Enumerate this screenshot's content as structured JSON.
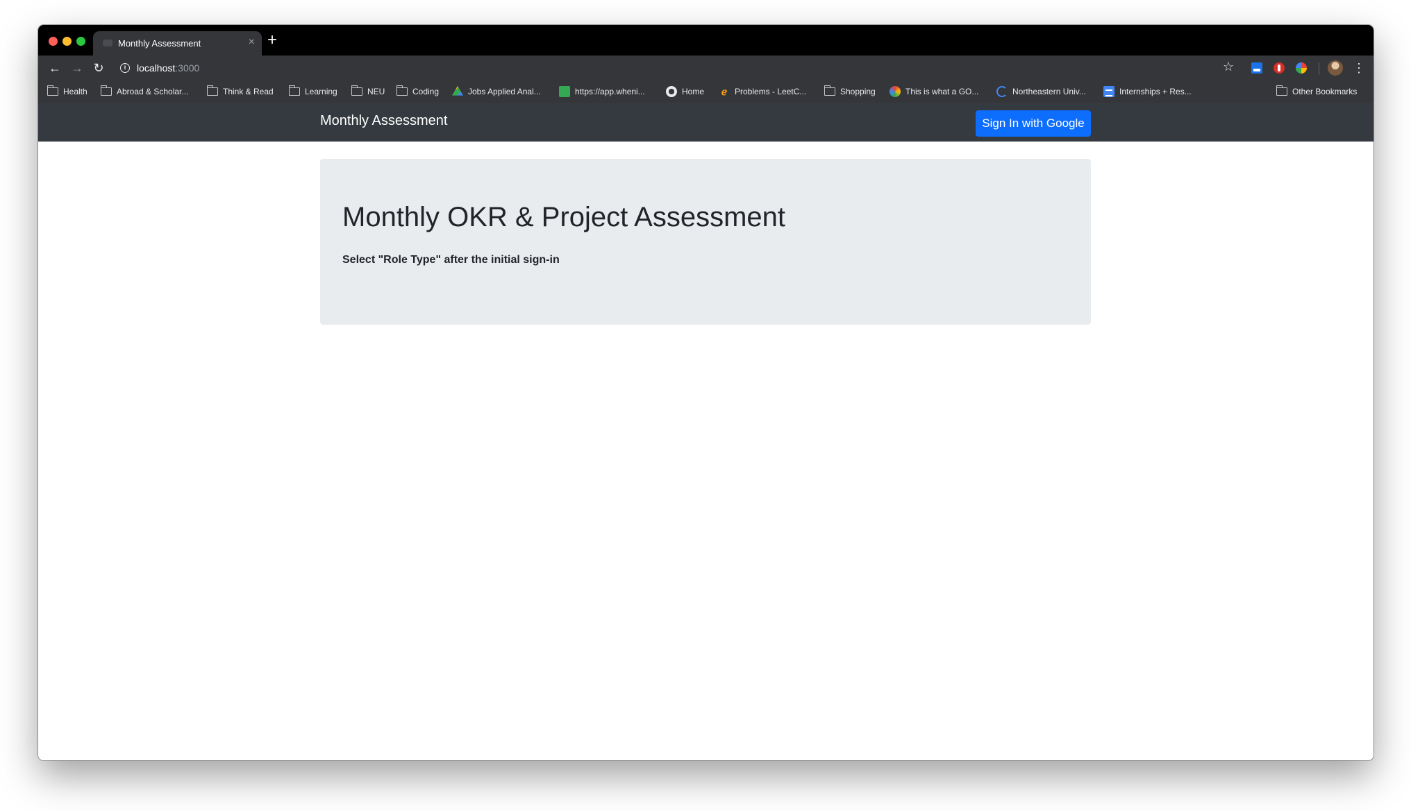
{
  "browser": {
    "tab_title": "Monthly Assessment",
    "tab_close": "×",
    "new_tab": "+",
    "url_host": "localhost",
    "url_port": ":3000"
  },
  "bookmarks": [
    {
      "label": "Health",
      "icon": "folder-icon"
    },
    {
      "label": "Abroad & Scholar...",
      "icon": "folder-icon"
    },
    {
      "label": "Think & Read",
      "icon": "folder-icon"
    },
    {
      "label": "Learning",
      "icon": "folder-icon"
    },
    {
      "label": "NEU",
      "icon": "folder-icon"
    },
    {
      "label": "Coding",
      "icon": "folder-icon"
    },
    {
      "label": "Jobs Applied Anal...",
      "icon": "google-drive-icon"
    },
    {
      "label": "https://app.wheni...",
      "icon": "green-doc-icon"
    },
    {
      "label": "Home",
      "icon": "globe-icon"
    },
    {
      "label": "Problems - LeetC...",
      "icon": "leetcode-icon"
    },
    {
      "label": "Shopping",
      "icon": "folder-icon"
    },
    {
      "label": "This is what a GO...",
      "icon": "swirl-icon"
    },
    {
      "label": "Northeastern Univ...",
      "icon": "northeastern-icon"
    },
    {
      "label": "Internships + Res...",
      "icon": "google-doc-icon"
    },
    {
      "label": "Other Bookmarks",
      "icon": "folder-icon"
    }
  ],
  "navbar": {
    "brand": "Monthly Assessment",
    "signin_label": "Sign In with Google"
  },
  "jumbotron": {
    "title": "Monthly OKR & Project Assessment",
    "subtitle": "Select \"Role Type\" after the initial sign-in"
  },
  "colors": {
    "navbar_bg": "#343a40",
    "primary_button": "#0d6efd",
    "jumbotron_bg": "#e9ecef"
  }
}
